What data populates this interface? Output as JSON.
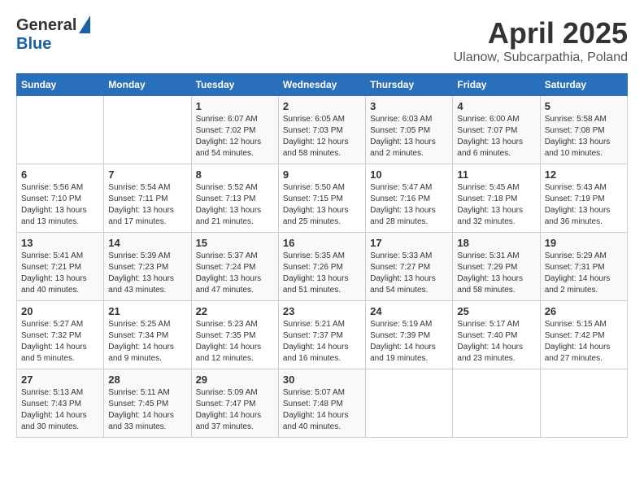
{
  "header": {
    "logo_general": "General",
    "logo_blue": "Blue",
    "title": "April 2025",
    "subtitle": "Ulanow, Subcarpathia, Poland"
  },
  "days_of_week": [
    "Sunday",
    "Monday",
    "Tuesday",
    "Wednesday",
    "Thursday",
    "Friday",
    "Saturday"
  ],
  "weeks": [
    [
      {
        "day": "",
        "detail": ""
      },
      {
        "day": "",
        "detail": ""
      },
      {
        "day": "1",
        "detail": "Sunrise: 6:07 AM\nSunset: 7:02 PM\nDaylight: 12 hours and 54 minutes."
      },
      {
        "day": "2",
        "detail": "Sunrise: 6:05 AM\nSunset: 7:03 PM\nDaylight: 12 hours and 58 minutes."
      },
      {
        "day": "3",
        "detail": "Sunrise: 6:03 AM\nSunset: 7:05 PM\nDaylight: 13 hours and 2 minutes."
      },
      {
        "day": "4",
        "detail": "Sunrise: 6:00 AM\nSunset: 7:07 PM\nDaylight: 13 hours and 6 minutes."
      },
      {
        "day": "5",
        "detail": "Sunrise: 5:58 AM\nSunset: 7:08 PM\nDaylight: 13 hours and 10 minutes."
      }
    ],
    [
      {
        "day": "6",
        "detail": "Sunrise: 5:56 AM\nSunset: 7:10 PM\nDaylight: 13 hours and 13 minutes."
      },
      {
        "day": "7",
        "detail": "Sunrise: 5:54 AM\nSunset: 7:11 PM\nDaylight: 13 hours and 17 minutes."
      },
      {
        "day": "8",
        "detail": "Sunrise: 5:52 AM\nSunset: 7:13 PM\nDaylight: 13 hours and 21 minutes."
      },
      {
        "day": "9",
        "detail": "Sunrise: 5:50 AM\nSunset: 7:15 PM\nDaylight: 13 hours and 25 minutes."
      },
      {
        "day": "10",
        "detail": "Sunrise: 5:47 AM\nSunset: 7:16 PM\nDaylight: 13 hours and 28 minutes."
      },
      {
        "day": "11",
        "detail": "Sunrise: 5:45 AM\nSunset: 7:18 PM\nDaylight: 13 hours and 32 minutes."
      },
      {
        "day": "12",
        "detail": "Sunrise: 5:43 AM\nSunset: 7:19 PM\nDaylight: 13 hours and 36 minutes."
      }
    ],
    [
      {
        "day": "13",
        "detail": "Sunrise: 5:41 AM\nSunset: 7:21 PM\nDaylight: 13 hours and 40 minutes."
      },
      {
        "day": "14",
        "detail": "Sunrise: 5:39 AM\nSunset: 7:23 PM\nDaylight: 13 hours and 43 minutes."
      },
      {
        "day": "15",
        "detail": "Sunrise: 5:37 AM\nSunset: 7:24 PM\nDaylight: 13 hours and 47 minutes."
      },
      {
        "day": "16",
        "detail": "Sunrise: 5:35 AM\nSunset: 7:26 PM\nDaylight: 13 hours and 51 minutes."
      },
      {
        "day": "17",
        "detail": "Sunrise: 5:33 AM\nSunset: 7:27 PM\nDaylight: 13 hours and 54 minutes."
      },
      {
        "day": "18",
        "detail": "Sunrise: 5:31 AM\nSunset: 7:29 PM\nDaylight: 13 hours and 58 minutes."
      },
      {
        "day": "19",
        "detail": "Sunrise: 5:29 AM\nSunset: 7:31 PM\nDaylight: 14 hours and 2 minutes."
      }
    ],
    [
      {
        "day": "20",
        "detail": "Sunrise: 5:27 AM\nSunset: 7:32 PM\nDaylight: 14 hours and 5 minutes."
      },
      {
        "day": "21",
        "detail": "Sunrise: 5:25 AM\nSunset: 7:34 PM\nDaylight: 14 hours and 9 minutes."
      },
      {
        "day": "22",
        "detail": "Sunrise: 5:23 AM\nSunset: 7:35 PM\nDaylight: 14 hours and 12 minutes."
      },
      {
        "day": "23",
        "detail": "Sunrise: 5:21 AM\nSunset: 7:37 PM\nDaylight: 14 hours and 16 minutes."
      },
      {
        "day": "24",
        "detail": "Sunrise: 5:19 AM\nSunset: 7:39 PM\nDaylight: 14 hours and 19 minutes."
      },
      {
        "day": "25",
        "detail": "Sunrise: 5:17 AM\nSunset: 7:40 PM\nDaylight: 14 hours and 23 minutes."
      },
      {
        "day": "26",
        "detail": "Sunrise: 5:15 AM\nSunset: 7:42 PM\nDaylight: 14 hours and 27 minutes."
      }
    ],
    [
      {
        "day": "27",
        "detail": "Sunrise: 5:13 AM\nSunset: 7:43 PM\nDaylight: 14 hours and 30 minutes."
      },
      {
        "day": "28",
        "detail": "Sunrise: 5:11 AM\nSunset: 7:45 PM\nDaylight: 14 hours and 33 minutes."
      },
      {
        "day": "29",
        "detail": "Sunrise: 5:09 AM\nSunset: 7:47 PM\nDaylight: 14 hours and 37 minutes."
      },
      {
        "day": "30",
        "detail": "Sunrise: 5:07 AM\nSunset: 7:48 PM\nDaylight: 14 hours and 40 minutes."
      },
      {
        "day": "",
        "detail": ""
      },
      {
        "day": "",
        "detail": ""
      },
      {
        "day": "",
        "detail": ""
      }
    ]
  ]
}
